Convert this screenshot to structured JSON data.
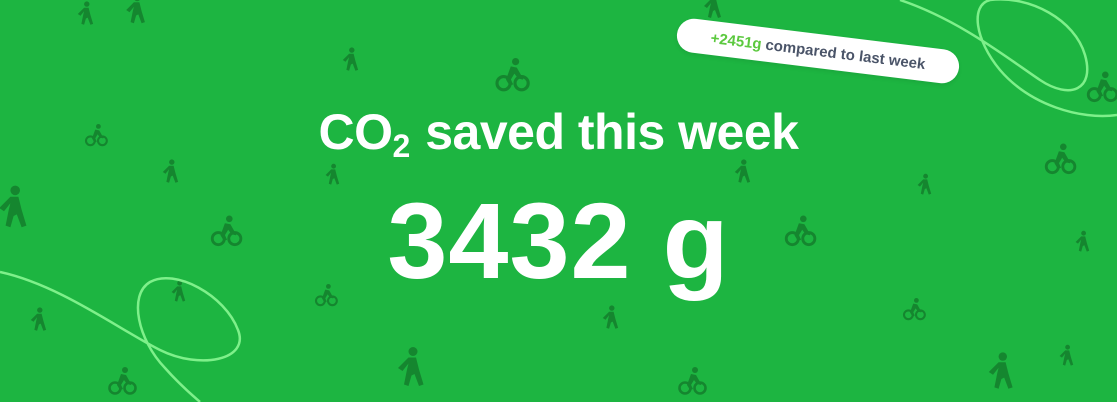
{
  "headline": {
    "prefix": "CO",
    "subscript": "2",
    "suffix": "saved this week"
  },
  "value": {
    "amount": "3432",
    "unit": "g"
  },
  "comparison": {
    "delta": "+2451g",
    "text": "compared to last week"
  },
  "colors": {
    "background": "#1db541",
    "pattern_icons": "#15862f",
    "decorative_lines": "#7ef08a",
    "delta_text": "#5cc93f",
    "pill_text": "#4a5468",
    "pill_background": "#ffffff",
    "headline_text": "#ffffff"
  },
  "icons": [
    "walking-person-icon",
    "cyclist-icon"
  ]
}
